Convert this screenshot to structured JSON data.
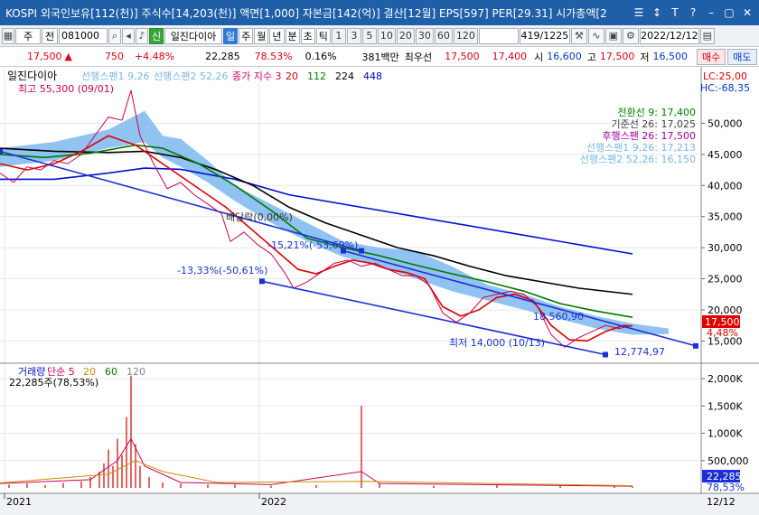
{
  "window": {
    "title": "KOSPI 외국인보유[112(천)] 주식수[14,203(천)] 액면[1,000] 자본금[142(억)] 결산[12월] EPS[597] PER[29.31] 시가총액[2",
    "buttons": [
      "☰",
      "↕",
      "T",
      "?",
      "–",
      "▢",
      "✕"
    ]
  },
  "toolbar": {
    "market": "주",
    "mode": "전",
    "code": "081000",
    "stock_badge": "신",
    "stock_name": "일진다이아",
    "periods": [
      "일",
      "주",
      "월",
      "년",
      "분",
      "초",
      "틱"
    ],
    "active_period": "일",
    "intervals": [
      "1",
      "3",
      "5",
      "10",
      "20",
      "30",
      "60",
      "120"
    ],
    "count": "419/1225",
    "date": "2022/12/12"
  },
  "pricebar": {
    "price": "17,500",
    "change": "750",
    "change_pct": "+4.48%",
    "volume": "22,285",
    "volume_ratio": "78.53%",
    "rate": "0.16%",
    "amount": "381백만",
    "best_label": "최우선",
    "best_ask": "17,500",
    "best_bid": "17,400",
    "open_label": "시",
    "open": "16,600",
    "high_label": "고",
    "high": "17,500",
    "low_label": "저",
    "low": "16,500",
    "buy_label": "매수",
    "sell_label": "매도"
  },
  "chart_data": {
    "type": "line",
    "title": "일진다이아",
    "x_ticks": [
      "2021",
      "2022"
    ],
    "y_ticks": [
      15000,
      20000,
      25000,
      30000,
      35000,
      40000,
      45000,
      50000
    ],
    "y_tick_labels": [
      "15,000",
      "20,000",
      "25,000",
      "30,000",
      "35,000",
      "40,000",
      "45,000",
      "50,000"
    ],
    "ylim": [
      12000,
      58500
    ],
    "top_legend": [
      {
        "text": "선행스팬1 9,26",
        "color": "#79b6ec"
      },
      {
        "text": "선행스팬2 52,26",
        "color": "#79b6ec"
      },
      {
        "text": "종가 지수 3",
        "color": "#d0005a"
      },
      {
        "text": "20",
        "color": "#e00000"
      },
      {
        "text": "112",
        "color": "#008000"
      },
      {
        "text": "224",
        "color": "#000000"
      },
      {
        "text": "448",
        "color": "#0000c0"
      }
    ],
    "right_legend": [
      {
        "text": "전환선 9: 17,400",
        "color": "#008000"
      },
      {
        "text": "기준선 26: 17,025",
        "color": "#404040"
      },
      {
        "text": "후행스팬 26: 17,500",
        "color": "#a000a0"
      },
      {
        "text": "선행스팬1 9,26: 17,213",
        "color": "#79b6ec"
      },
      {
        "text": "선행스팬2 52,26: 16,150",
        "color": "#79b6ec"
      }
    ],
    "lc_label": "LC:25,00",
    "hc_label": "HC:-68,35",
    "annotations": {
      "high": "최고 55,300 (09/01)",
      "low": "최저 14,000 (10/13)",
      "drop": "배당락(0,00%)",
      "pct1": "-15,21%(-53,69%)",
      "pct2": "-13,33%(-50,61%)",
      "level1": "18,560,90",
      "level2": "12,774,97"
    },
    "current_price_label": "17,500",
    "current_pct_label": "4,48%",
    "series": [
      {
        "key": "ma448",
        "color": "#0010d0",
        "points": [
          [
            0,
            41000
          ],
          [
            60,
            41000
          ],
          [
            120,
            42000
          ],
          [
            160,
            42800
          ],
          [
            200,
            42600
          ],
          [
            260,
            41000
          ],
          [
            320,
            38500
          ],
          [
            400,
            36500
          ],
          [
            480,
            34500
          ],
          [
            560,
            32500
          ],
          [
            640,
            30500
          ],
          [
            700,
            29000
          ]
        ]
      },
      {
        "key": "ma224",
        "color": "#000000",
        "points": [
          [
            0,
            46000
          ],
          [
            60,
            45500
          ],
          [
            120,
            45300
          ],
          [
            160,
            45500
          ],
          [
            200,
            44500
          ],
          [
            240,
            42500
          ],
          [
            280,
            40000
          ],
          [
            320,
            36500
          ],
          [
            360,
            34000
          ],
          [
            400,
            32000
          ],
          [
            440,
            30000
          ],
          [
            480,
            28700
          ],
          [
            520,
            27000
          ],
          [
            560,
            25500
          ],
          [
            600,
            24500
          ],
          [
            640,
            23500
          ],
          [
            700,
            22500
          ]
        ]
      },
      {
        "key": "ma112",
        "color": "#007a00",
        "points": [
          [
            0,
            45000
          ],
          [
            50,
            44500
          ],
          [
            100,
            45200
          ],
          [
            150,
            46500
          ],
          [
            180,
            46000
          ],
          [
            220,
            43500
          ],
          [
            260,
            40000
          ],
          [
            300,
            36000
          ],
          [
            340,
            31500
          ],
          [
            380,
            30000
          ],
          [
            420,
            28700
          ],
          [
            460,
            27200
          ],
          [
            500,
            25800
          ],
          [
            540,
            24500
          ],
          [
            580,
            23000
          ],
          [
            620,
            21000
          ],
          [
            660,
            19800
          ],
          [
            700,
            18800
          ]
        ]
      },
      {
        "key": "ma20",
        "color": "#e00000",
        "points": [
          [
            0,
            43500
          ],
          [
            30,
            42500
          ],
          [
            60,
            43500
          ],
          [
            90,
            45500
          ],
          [
            120,
            48000
          ],
          [
            150,
            46500
          ],
          [
            170,
            44500
          ],
          [
            190,
            42500
          ],
          [
            210,
            40500
          ],
          [
            230,
            38500
          ],
          [
            250,
            36500
          ],
          [
            270,
            34000
          ],
          [
            290,
            31500
          ],
          [
            310,
            29000
          ],
          [
            330,
            26500
          ],
          [
            350,
            25800
          ],
          [
            370,
            27000
          ],
          [
            390,
            28000
          ],
          [
            410,
            27500
          ],
          [
            430,
            26500
          ],
          [
            450,
            26000
          ],
          [
            470,
            25000
          ],
          [
            490,
            20500
          ],
          [
            510,
            19000
          ],
          [
            530,
            20000
          ],
          [
            550,
            22000
          ],
          [
            570,
            22500
          ],
          [
            590,
            21500
          ],
          [
            610,
            17500
          ],
          [
            630,
            15200
          ],
          [
            650,
            15000
          ],
          [
            670,
            16500
          ],
          [
            690,
            17500
          ],
          [
            700,
            17400
          ]
        ]
      },
      {
        "key": "close",
        "color": "#d0004a",
        "points": [
          [
            0,
            42000
          ],
          [
            15,
            40500
          ],
          [
            30,
            43000
          ],
          [
            45,
            42500
          ],
          [
            60,
            44000
          ],
          [
            75,
            43500
          ],
          [
            90,
            45000
          ],
          [
            105,
            48000
          ],
          [
            120,
            51000
          ],
          [
            135,
            50500
          ],
          [
            145,
            55300
          ],
          [
            155,
            48000
          ],
          [
            170,
            43500
          ],
          [
            185,
            39500
          ],
          [
            200,
            40500
          ],
          [
            215,
            38500
          ],
          [
            230,
            37000
          ],
          [
            245,
            35500
          ],
          [
            255,
            31000
          ],
          [
            270,
            32500
          ],
          [
            285,
            30500
          ],
          [
            300,
            29000
          ],
          [
            315,
            26000
          ],
          [
            325,
            23500
          ],
          [
            340,
            24500
          ],
          [
            355,
            26000
          ],
          [
            370,
            27500
          ],
          [
            385,
            28000
          ],
          [
            400,
            27000
          ],
          [
            415,
            27500
          ],
          [
            430,
            26500
          ],
          [
            445,
            25500
          ],
          [
            460,
            25500
          ],
          [
            475,
            24000
          ],
          [
            490,
            19500
          ],
          [
            505,
            18000
          ],
          [
            520,
            19500
          ],
          [
            535,
            22000
          ],
          [
            550,
            22500
          ],
          [
            565,
            23000
          ],
          [
            580,
            22500
          ],
          [
            595,
            20500
          ],
          [
            610,
            16000
          ],
          [
            625,
            14000
          ],
          [
            640,
            15500
          ],
          [
            655,
            16500
          ],
          [
            670,
            17500
          ],
          [
            685,
            17000
          ],
          [
            700,
            17500
          ]
        ]
      },
      {
        "key": "trend1",
        "color": "#1c2fd6",
        "points": [
          [
            290,
            24600
          ],
          [
            670,
            12800
          ]
        ]
      },
      {
        "key": "trend2",
        "color": "#1c2fd6",
        "points": [
          [
            380,
            29500
          ],
          [
            770,
            14200
          ]
        ]
      },
      {
        "key": "trend3",
        "color": "#1c2fd6",
        "points": [
          [
            0,
            45500
          ],
          [
            400,
            29500
          ]
        ]
      }
    ],
    "cloud": [
      [
        0,
        46000,
        43000
      ],
      [
        60,
        47000,
        44000
      ],
      [
        120,
        49000,
        46000
      ],
      [
        160,
        52000,
        47000
      ],
      [
        180,
        48000,
        44500
      ],
      [
        200,
        47500,
        43000
      ],
      [
        230,
        44000,
        40500
      ],
      [
        260,
        40000,
        37500
      ],
      [
        300,
        37000,
        34000
      ],
      [
        340,
        34000,
        31000
      ],
      [
        380,
        31000,
        28500
      ],
      [
        420,
        30000,
        27000
      ],
      [
        460,
        29500,
        25000
      ],
      [
        500,
        27000,
        23000
      ],
      [
        540,
        24000,
        21500
      ],
      [
        580,
        22500,
        20000
      ],
      [
        620,
        20500,
        18500
      ],
      [
        660,
        19000,
        17000
      ],
      [
        700,
        17800,
        16000
      ],
      [
        740,
        17000,
        16100
      ]
    ],
    "volume": {
      "legend": [
        {
          "text": "거래량",
          "color": "#0010d0"
        },
        {
          "text": "단순 5",
          "color": "#d0005a"
        },
        {
          "text": "20",
          "color": "#c89000"
        },
        {
          "text": "60",
          "color": "#008000"
        },
        {
          "text": "120",
          "color": "#888888"
        }
      ],
      "current": "22,285주(78,53%)",
      "y_ticks": [
        500000,
        1000000,
        1500000,
        2000000
      ],
      "y_tick_labels": [
        "500,000",
        "1,000K",
        "1,500K",
        "2,000K"
      ],
      "ymax": 2150000,
      "current_label": "22,285",
      "current_pct": "78,53%",
      "bars": [
        [
          10,
          60000
        ],
        [
          30,
          80000
        ],
        [
          50,
          50000
        ],
        [
          70,
          90000
        ],
        [
          90,
          120000
        ],
        [
          100,
          200000
        ],
        [
          110,
          300000
        ],
        [
          115,
          450000
        ],
        [
          120,
          700000
        ],
        [
          125,
          400000
        ],
        [
          130,
          900000
        ],
        [
          135,
          600000
        ],
        [
          140,
          1300000
        ],
        [
          145,
          2050000
        ],
        [
          150,
          800000
        ],
        [
          155,
          400000
        ],
        [
          165,
          200000
        ],
        [
          180,
          100000
        ],
        [
          200,
          80000
        ],
        [
          230,
          60000
        ],
        [
          260,
          60000
        ],
        [
          300,
          40000
        ],
        [
          350,
          50000
        ],
        [
          400,
          1500000
        ],
        [
          420,
          80000
        ],
        [
          480,
          40000
        ],
        [
          550,
          50000
        ],
        [
          620,
          40000
        ],
        [
          680,
          30000
        ],
        [
          700,
          22285
        ]
      ],
      "ma5": [
        [
          0,
          80000
        ],
        [
          100,
          150000
        ],
        [
          130,
          500000
        ],
        [
          145,
          900000
        ],
        [
          160,
          400000
        ],
        [
          200,
          100000
        ],
        [
          300,
          60000
        ],
        [
          400,
          300000
        ],
        [
          420,
          80000
        ],
        [
          700,
          30000
        ]
      ],
      "ma20": [
        [
          0,
          90000
        ],
        [
          120,
          250000
        ],
        [
          150,
          500000
        ],
        [
          180,
          300000
        ],
        [
          240,
          100000
        ],
        [
          400,
          120000
        ],
        [
          700,
          40000
        ]
      ]
    },
    "date_axis": {
      "left": "2021",
      "mid": "2022",
      "right": "12/12"
    }
  }
}
